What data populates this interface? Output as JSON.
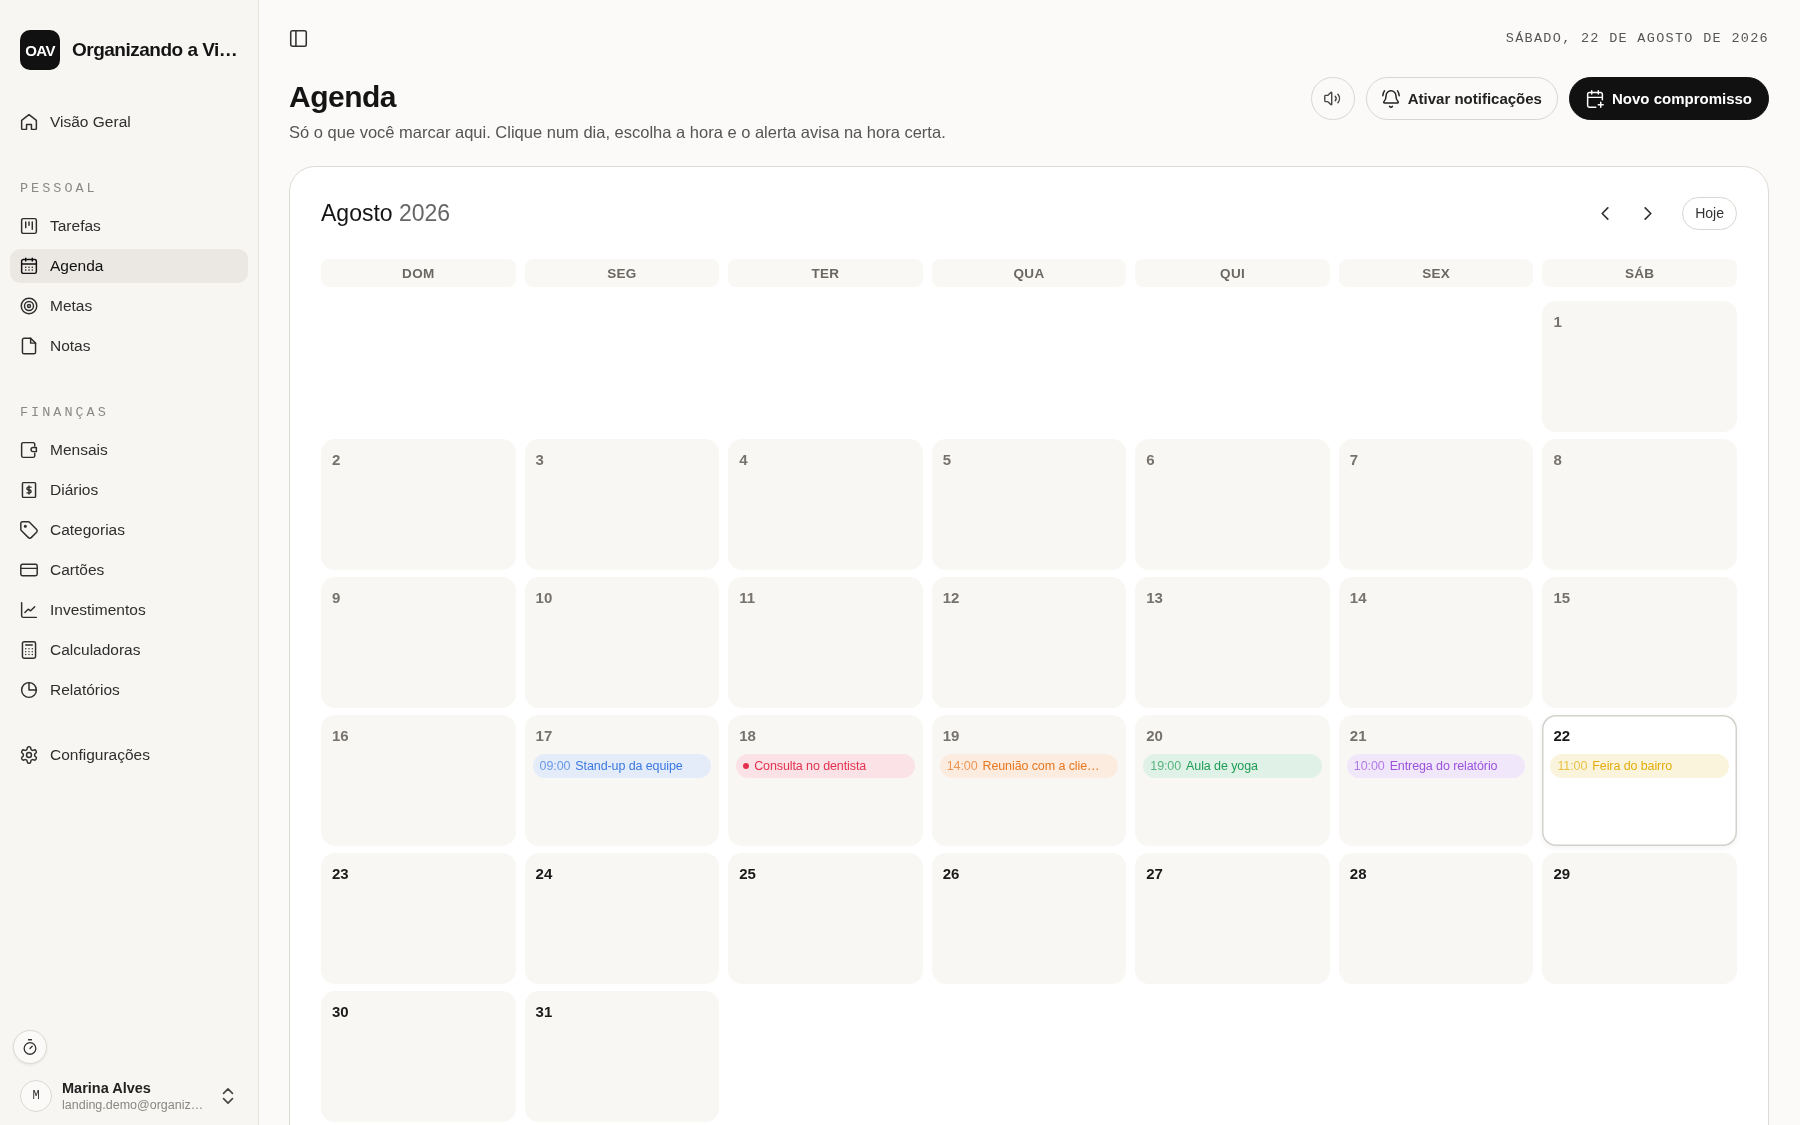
{
  "sidebar": {
    "logo": "OAV",
    "app_name": "Organizando a Vi…",
    "items": [
      {
        "label": "Visão Geral",
        "selected": false
      }
    ],
    "sections": [
      {
        "title": "PESSOAL",
        "items": [
          {
            "label": "Tarefas",
            "selected": false
          },
          {
            "label": "Agenda",
            "selected": true
          },
          {
            "label": "Metas",
            "selected": false
          },
          {
            "label": "Notas",
            "selected": false
          }
        ]
      },
      {
        "title": "FINANÇAS",
        "items": [
          {
            "label": "Mensais",
            "selected": false
          },
          {
            "label": "Diários",
            "selected": false
          },
          {
            "label": "Categorias",
            "selected": false
          },
          {
            "label": "Cartões",
            "selected": false
          },
          {
            "label": "Investimentos",
            "selected": false
          },
          {
            "label": "Calculadoras",
            "selected": false
          },
          {
            "label": "Relatórios",
            "selected": false
          }
        ]
      }
    ],
    "footer_items": [
      {
        "label": "Configurações",
        "selected": false
      }
    ],
    "user": {
      "avatar": "M",
      "name": "Marina Alves",
      "email": "landing.demo@organiz…"
    }
  },
  "header": {
    "date": "SÁBADO, 22 DE AGOSTO DE 2026",
    "title": "Agenda",
    "subtitle": "Só o que você marcar aqui. Clique num dia, escolha a hora e o alerta avisa na hora certa.",
    "buttons": [
      {
        "kind": "icon"
      },
      {
        "kind": "outline",
        "label": "Ativar notificações"
      },
      {
        "kind": "primary",
        "label": "Novo compromisso"
      }
    ]
  },
  "calendar": {
    "month": "Agosto",
    "year": "2026",
    "today_button": "Hoje",
    "weekdays": [
      "DOM",
      "SEG",
      "TER",
      "QUA",
      "QUI",
      "SEX",
      "SÁB"
    ],
    "weeks": [
      {
        "days": [
          {
            "day": "1",
            "past": true,
            "today": false
          }
        ]
      },
      {
        "days": [
          {
            "day": "2",
            "past": true,
            "today": false
          },
          {
            "day": "3",
            "past": true,
            "today": false
          },
          {
            "day": "4",
            "past": true,
            "today": false
          },
          {
            "day": "5",
            "past": true,
            "today": false
          },
          {
            "day": "6",
            "past": true,
            "today": false
          },
          {
            "day": "7",
            "past": true,
            "today": false
          },
          {
            "day": "8",
            "past": true,
            "today": false
          }
        ]
      },
      {
        "days": [
          {
            "day": "9",
            "past": true,
            "today": false
          },
          {
            "day": "10",
            "past": true,
            "today": false
          },
          {
            "day": "11",
            "past": true,
            "today": false
          },
          {
            "day": "12",
            "past": true,
            "today": false
          },
          {
            "day": "13",
            "past": true,
            "today": false
          },
          {
            "day": "14",
            "past": true,
            "today": false
          },
          {
            "day": "15",
            "past": true,
            "today": false
          }
        ]
      },
      {
        "days": [
          {
            "day": "16",
            "past": true,
            "today": false
          },
          {
            "day": "17",
            "past": true,
            "today": false,
            "events": [
              {
                "kind": "timed",
                "time": "09:00",
                "title": "Stand-up da equipe",
                "color": "#3b78de"
              }
            ]
          },
          {
            "day": "18",
            "past": true,
            "today": false,
            "events": [
              {
                "kind": "untimed",
                "title": "Consulta no dentista",
                "color": "#e2324f"
              }
            ]
          },
          {
            "day": "19",
            "past": true,
            "today": false,
            "events": [
              {
                "kind": "timed",
                "time": "14:00",
                "title": "Reunião com a clie…",
                "color": "#e8761e"
              }
            ]
          },
          {
            "day": "20",
            "past": true,
            "today": false,
            "events": [
              {
                "kind": "timed",
                "time": "19:00",
                "title": "Aula de yoga",
                "color": "#1f9d55"
              }
            ]
          },
          {
            "day": "21",
            "past": true,
            "today": false,
            "events": [
              {
                "kind": "timed",
                "time": "10:00",
                "title": "Entrega do relatório",
                "color": "#9a52dc"
              }
            ]
          },
          {
            "day": "22",
            "past": false,
            "today": true,
            "events": [
              {
                "kind": "timed",
                "time": "11:00",
                "title": "Feira do bairro",
                "color": "#e2ad0c"
              }
            ]
          }
        ]
      },
      {
        "days": [
          {
            "day": "23",
            "past": false,
            "today": false
          },
          {
            "day": "24",
            "past": false,
            "today": false
          },
          {
            "day": "25",
            "past": false,
            "today": false
          },
          {
            "day": "26",
            "past": false,
            "today": false
          },
          {
            "day": "27",
            "past": false,
            "today": false
          },
          {
            "day": "28",
            "past": false,
            "today": false
          },
          {
            "day": "29",
            "past": false,
            "today": false
          }
        ]
      },
      {
        "days": [
          {
            "day": "30",
            "past": false,
            "today": false
          },
          {
            "day": "31",
            "past": false,
            "today": false
          }
        ]
      }
    ]
  }
}
